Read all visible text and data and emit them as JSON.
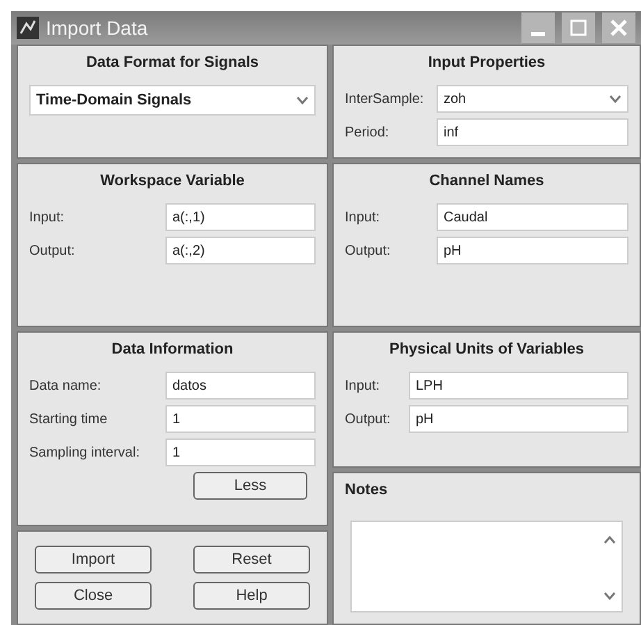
{
  "window": {
    "title": "Import Data"
  },
  "data_format": {
    "title": "Data Format for Signals",
    "value": "Time-Domain Signals"
  },
  "input_properties": {
    "title": "Input Properties",
    "fields": [
      {
        "kind": "dropdown",
        "label": "InterSample:",
        "value": "zoh"
      },
      {
        "kind": "text",
        "label": "Period:",
        "value": "inf"
      }
    ]
  },
  "workspace_variable": {
    "title": "Workspace Variable",
    "fields": [
      {
        "kind": "text",
        "label": "Input:",
        "value": "a(:,1)"
      },
      {
        "kind": "text",
        "label": "Output:",
        "value": "a(:,2)"
      }
    ]
  },
  "channel_names": {
    "title": "Channel Names",
    "fields": [
      {
        "kind": "text",
        "label": "Input:",
        "value": "Caudal"
      },
      {
        "kind": "text",
        "label": "Output:",
        "value": "pH"
      }
    ]
  },
  "data_information": {
    "title": "Data Information",
    "fields": [
      {
        "kind": "text",
        "label": "Data name:",
        "value": "datos"
      },
      {
        "kind": "text",
        "label": "Starting time",
        "value": "1"
      },
      {
        "kind": "text",
        "label": "Sampling interval:",
        "value": "1"
      }
    ],
    "toggle_button": "Less"
  },
  "physical_units": {
    "title": "Physical Units of Variables",
    "fields": [
      {
        "kind": "text",
        "label": "Input:",
        "value": "LPH"
      },
      {
        "kind": "text",
        "label": "Output:",
        "value": "pH"
      }
    ]
  },
  "notes": {
    "title": "Notes"
  },
  "buttons": [
    "Import",
    "Reset",
    "Close",
    "Help"
  ]
}
